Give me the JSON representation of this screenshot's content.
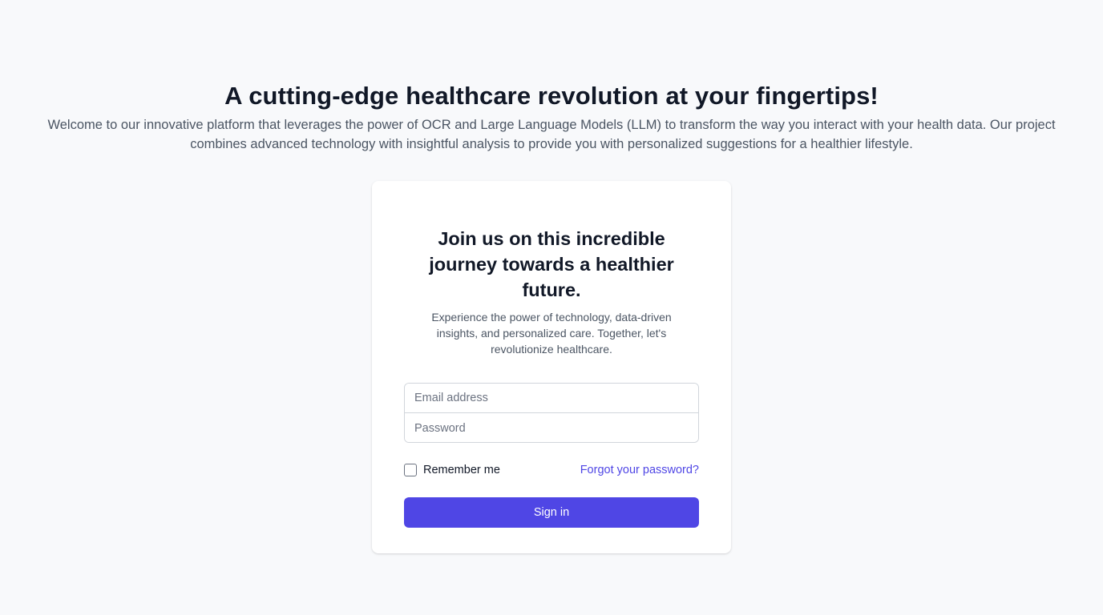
{
  "hero": {
    "title": "A cutting-edge healthcare revolution at your fingertips!",
    "description": "Welcome to our innovative platform that leverages the power of OCR and Large Language Models (LLM) to transform the way you interact with your health data. Our project combines advanced technology with insightful analysis to provide you with personalized suggestions for a healthier lifestyle."
  },
  "login_card": {
    "title": "Join us on this incredible journey towards a healthier future.",
    "subtitle": "Experience the power of technology, data-driven insights, and personalized care. Together, let's revolutionize healthcare.",
    "email": {
      "placeholder": "Email address",
      "value": ""
    },
    "password": {
      "placeholder": "Password",
      "value": ""
    },
    "remember_label": "Remember me",
    "remember_checked": false,
    "forgot_label": "Forgot your password?",
    "signin_label": "Sign in"
  },
  "colors": {
    "background": "#f8f9fb",
    "accent": "#4f46e5",
    "heading": "#111827",
    "body_text": "#4b5563"
  }
}
